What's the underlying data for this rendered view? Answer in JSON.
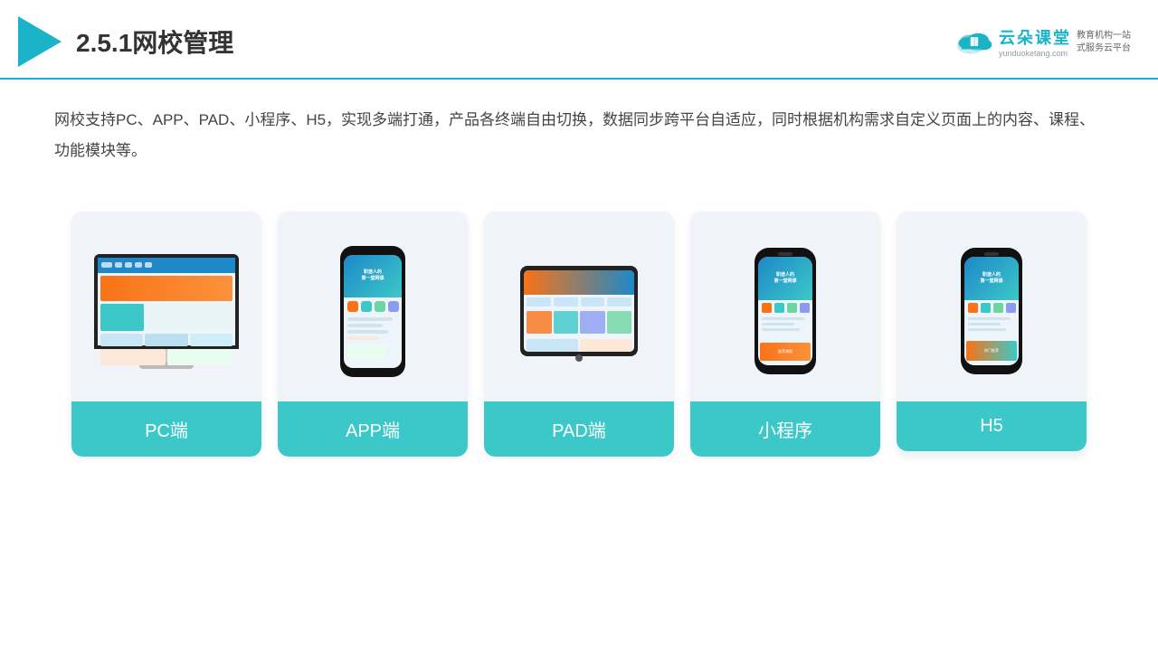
{
  "header": {
    "title": "2.5.1网校管理",
    "brand": {
      "name": "云朵课堂",
      "url": "yunduoketang.com",
      "slogan_line1": "教育机构一站",
      "slogan_line2": "式服务云平台"
    }
  },
  "description": "网校支持PC、APP、PAD、小程序、H5，实现多端打通，产品各终端自由切换，数据同步跨平台自适应，同时根据机构需求自定义页面上的内容、课程、功能模块等。",
  "cards": [
    {
      "id": "pc",
      "label": "PC端"
    },
    {
      "id": "app",
      "label": "APP端"
    },
    {
      "id": "pad",
      "label": "PAD端"
    },
    {
      "id": "miniprogram",
      "label": "小程序"
    },
    {
      "id": "h5",
      "label": "H5"
    }
  ],
  "colors": {
    "accent": "#1ab3c8",
    "card_bg": "#f0f4f8",
    "card_label_bg": "#3cc8c8"
  }
}
